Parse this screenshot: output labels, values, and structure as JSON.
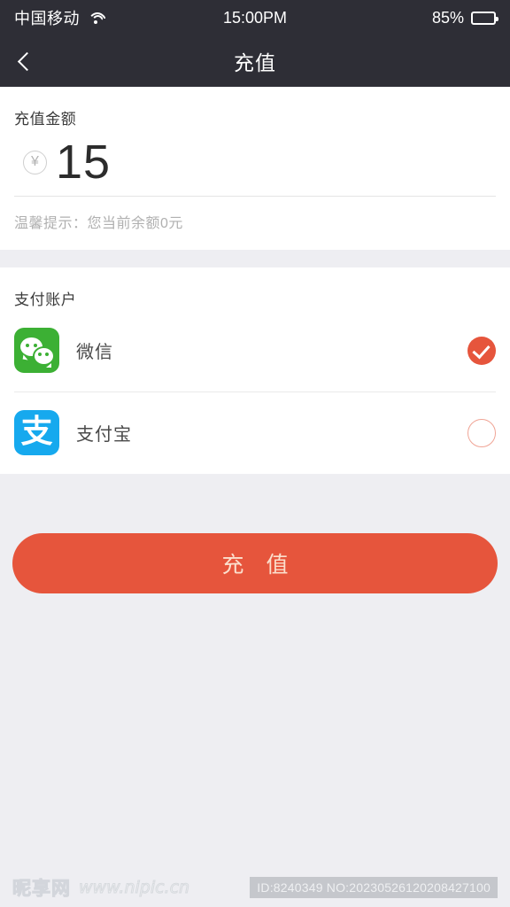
{
  "status_bar": {
    "carrier": "中国移动",
    "wifi_icon": "wifi-icon",
    "time": "15:00PM",
    "battery_percent": "85%",
    "battery_level": 62
  },
  "nav_bar": {
    "back_icon": "chevron-left-icon",
    "title": "充值"
  },
  "amount_section": {
    "label": "充值金额",
    "currency_icon": "¥",
    "value": "15",
    "hint": "温馨提示：您当前余额0元"
  },
  "payment_section": {
    "label": "支付账户",
    "methods": [
      {
        "name": "微信",
        "icon": "wechat-icon",
        "selected": true,
        "selected_icon": "check-circle-icon"
      },
      {
        "name": "支付宝",
        "icon": "alipay-icon",
        "glyph": "支",
        "selected": false,
        "selected_icon": "empty-circle-icon"
      }
    ]
  },
  "submit": {
    "label": "充 值"
  },
  "watermark": {
    "brand": "昵享网",
    "url": "www.nipic.cn",
    "id_text": "ID:8240349 NO:20230526120208427100"
  },
  "colors": {
    "accent": "#e6553c",
    "nav_bg": "#2e2e36",
    "page_bg": "#eeeef2",
    "wechat_green": "#3cb034",
    "alipay_blue": "#16a9ee"
  }
}
